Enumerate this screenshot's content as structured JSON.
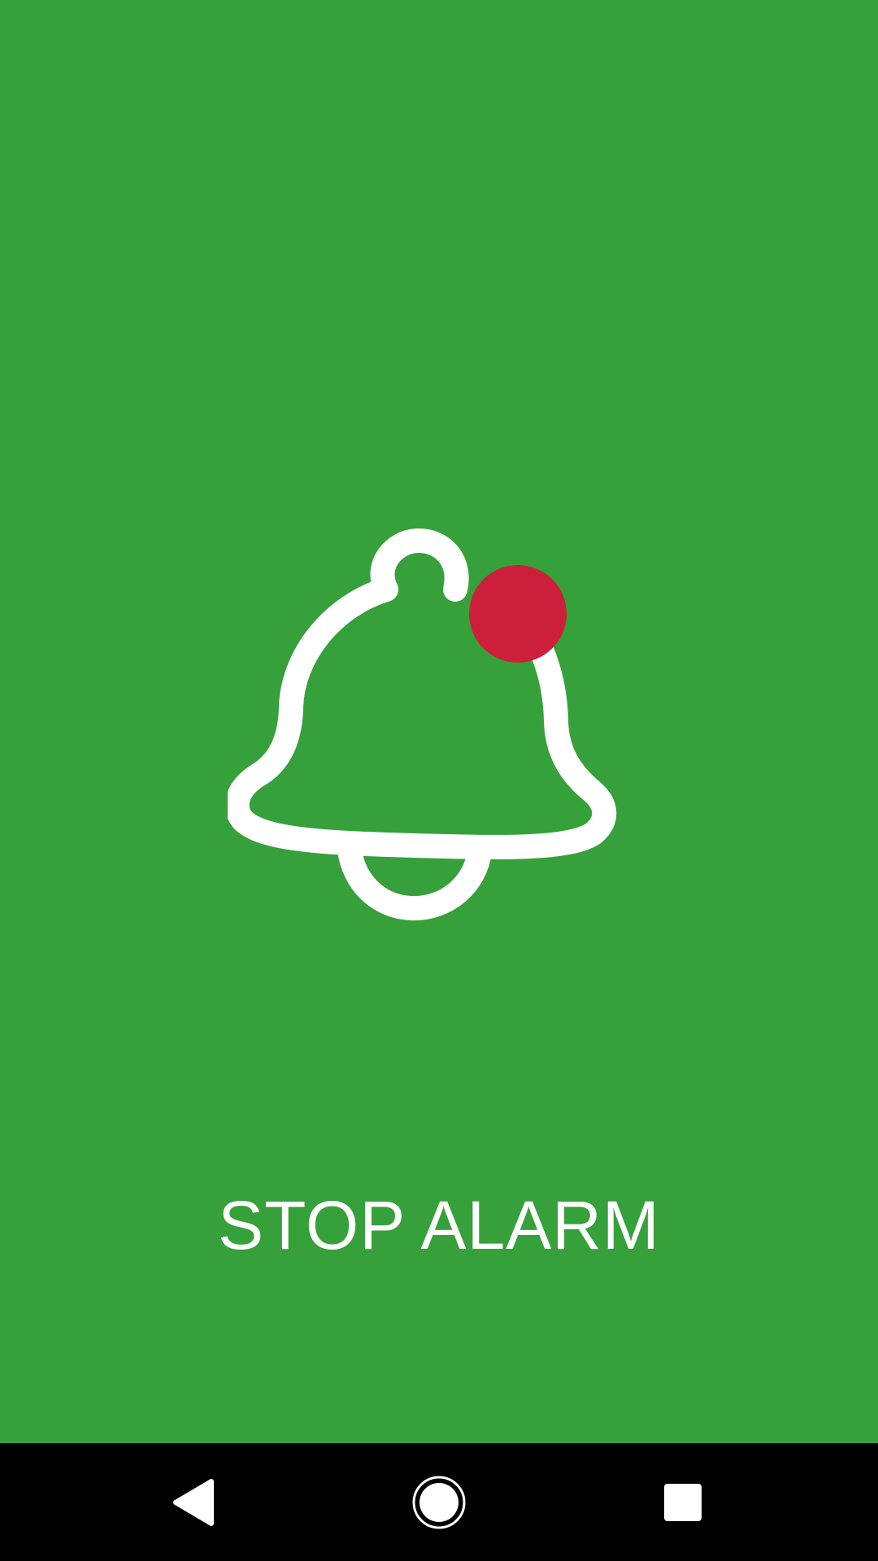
{
  "alarm": {
    "stop_label": "STOP ALARM",
    "bell_icon": "bell-icon",
    "notification_dot_icon": "notification-dot-icon"
  },
  "colors": {
    "background": "#36a03b",
    "foreground": "#ffffff",
    "notification_dot": "#cc1f3c",
    "nav_bar": "#000000"
  },
  "nav_bar": {
    "back_icon": "back-triangle-icon",
    "home_icon": "home-circle-icon",
    "recents_icon": "recents-square-icon"
  }
}
